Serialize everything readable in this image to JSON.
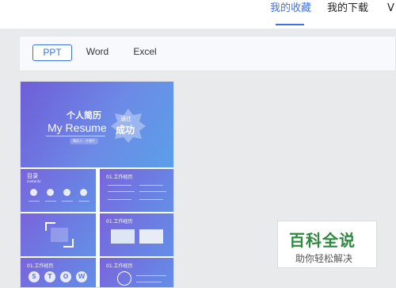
{
  "header": {
    "tabs": [
      {
        "label": "我的收藏",
        "active": true
      },
      {
        "label": "我的下载",
        "active": false
      },
      {
        "label": "V",
        "active": false
      }
    ]
  },
  "filters": {
    "options": [
      {
        "label": "PPT",
        "active": true
      },
      {
        "label": "Word",
        "active": false
      },
      {
        "label": "Excel",
        "active": false
      }
    ]
  },
  "thumbnail": {
    "title": "个人简历",
    "subtitle": "My Resume",
    "tag": "简历人：片吧片",
    "badge_top": "通往",
    "badge_main": "成功",
    "slide2_label": "目录",
    "slide2_sublabel": "contents",
    "slide3_label": "01.工作经历",
    "slide5_label": "01.工作经历",
    "slide6_label": "01.工作经历",
    "slide7_label": "01.工作经历",
    "circle_letters": [
      "S",
      "T",
      "O",
      "W"
    ]
  },
  "watermark": {
    "main": "百科全说",
    "sub": "助你轻松解决"
  },
  "colors": {
    "accent": "#3b73e6",
    "watermark_green": "#2b8a3e"
  }
}
